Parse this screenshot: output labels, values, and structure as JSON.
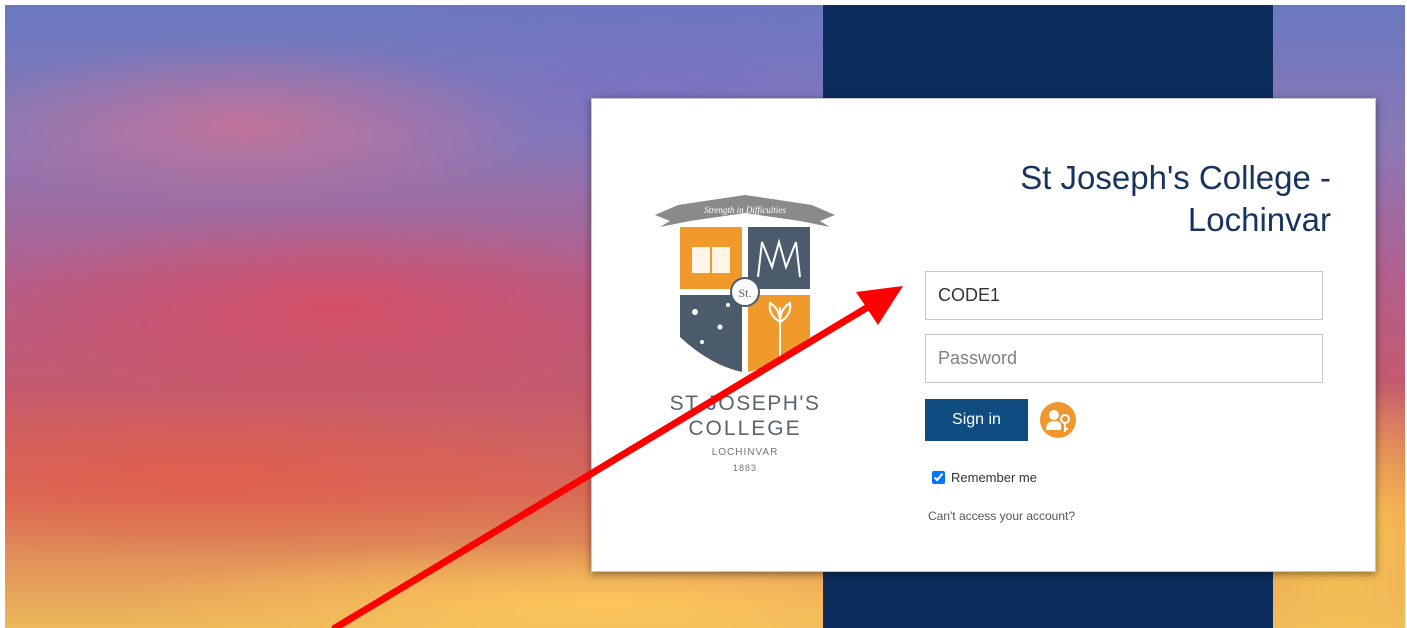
{
  "college": {
    "title_line1": "St Joseph's College -",
    "title_line2": "Lochinvar"
  },
  "crest": {
    "motto": "Strength in Difficulties",
    "monogram": "St.",
    "name_line1": "ST JOSEPH'S",
    "name_line2": "COLLEGE",
    "location": "LOCHINVAR",
    "year": "1883",
    "colors": {
      "orange": "#ef9a2a",
      "slate": "#4b5b6c",
      "ribbon": "#8a8a8a"
    }
  },
  "login": {
    "username_value": "CODE1",
    "password_placeholder": "Password",
    "signin_label": "Sign in",
    "remember_label": "Remember me",
    "remember_checked": true,
    "cant_access_label": "Can't access your account?",
    "key_icon": "key-person-icon"
  },
  "annotation": {
    "arrow_color": "#ff0000",
    "arrow_icon": "red-arrow-annotation"
  },
  "colors": {
    "navy_band": "#0d2d5c",
    "button": "#0f4c82",
    "title": "#17335f",
    "key_orange": "#f0962e"
  }
}
